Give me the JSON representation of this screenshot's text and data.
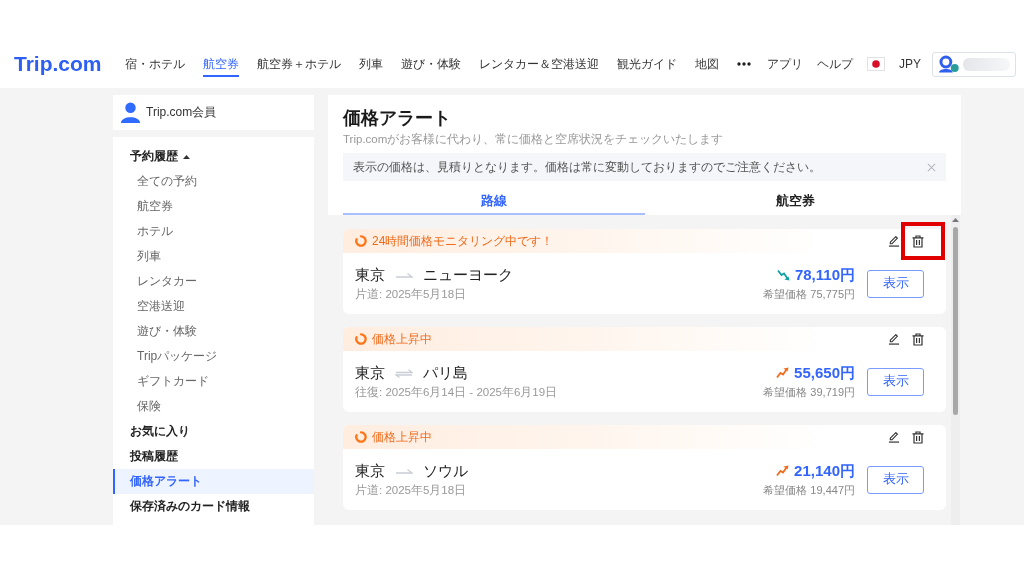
{
  "header": {
    "logo": "Trip.com",
    "nav": [
      {
        "label": "宿・ホテル",
        "selected": false
      },
      {
        "label": "航空券",
        "selected": true
      },
      {
        "label": "航空券＋ホテル",
        "selected": false
      },
      {
        "label": "列車",
        "selected": false
      },
      {
        "label": "遊び・体験",
        "selected": false
      },
      {
        "label": "レンタカー＆空港送迎",
        "selected": false
      },
      {
        "label": "観光ガイド",
        "selected": false
      },
      {
        "label": "地図",
        "selected": false
      }
    ],
    "links": [
      "アプリ",
      "ヘルプ"
    ],
    "currency": "JPY"
  },
  "sidebar": {
    "member": "Trip.com会員",
    "menu": [
      {
        "label": "予約履歴",
        "selected": false,
        "expanded": true,
        "children": [
          {
            "label": "全ての予約",
            "selected": false
          },
          {
            "label": "航空券",
            "selected": false
          },
          {
            "label": "ホテル",
            "selected": false
          },
          {
            "label": "列車",
            "selected": false
          },
          {
            "label": "レンタカー",
            "selected": false
          },
          {
            "label": "空港送迎",
            "selected": false
          },
          {
            "label": "遊び・体験",
            "selected": false
          },
          {
            "label": "Tripパッケージ",
            "selected": false
          },
          {
            "label": "ギフトカード",
            "selected": false
          },
          {
            "label": "保険",
            "selected": false
          }
        ]
      },
      {
        "label": "お気に入り",
        "selected": false
      },
      {
        "label": "投稿履歴",
        "selected": false
      },
      {
        "label": "価格アラート",
        "selected": true
      },
      {
        "label": "保存済みのカード情報",
        "selected": false
      }
    ]
  },
  "page": {
    "title": "価格アラート",
    "subtitle": "Trip.comがお客様に代わり、常に価格と空席状況をチェックいたします",
    "notice": "表示の価格は、見積りとなります。価格は常に変動しておりますのでご注意ください。"
  },
  "tabs": [
    {
      "label": "路線",
      "selected": true
    },
    {
      "label": "航空券",
      "selected": false
    }
  ],
  "alerts": [
    {
      "status": "24時間価格モニタリング中です！",
      "origin": "東京",
      "destination": "ニューヨーク",
      "round_trip": false,
      "dates": "片道: 2025年5月18日",
      "price_rising": false,
      "price": "78,110円",
      "target": "希望価格 75,775円",
      "button": "表示",
      "highlighted": true
    },
    {
      "status": "価格上昇中",
      "origin": "東京",
      "destination": "パリ島",
      "round_trip": true,
      "dates": "往復: 2025年6月14日 - 2025年6月19日",
      "price_rising": true,
      "price": "55,650円",
      "target": "希望価格 39,719円",
      "button": "表示",
      "highlighted": false
    },
    {
      "status": "価格上昇中",
      "origin": "東京",
      "destination": "ソウル",
      "round_trip": false,
      "dates": "片道: 2025年5月18日",
      "price_rising": true,
      "price": "21,140円",
      "target": "希望価格 19,447円",
      "button": "表示",
      "highlighted": false
    }
  ]
}
